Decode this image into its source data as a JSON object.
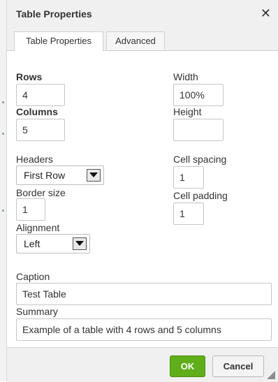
{
  "dialog": {
    "title": "Table Properties",
    "close_icon": "close-icon"
  },
  "tabs": [
    {
      "label": "Table Properties",
      "active": true
    },
    {
      "label": "Advanced",
      "active": false
    }
  ],
  "fields": {
    "rows": {
      "label": "Rows",
      "value": "4"
    },
    "columns": {
      "label": "Columns",
      "value": "5"
    },
    "width": {
      "label": "Width",
      "value": "100%"
    },
    "height": {
      "label": "Height",
      "value": ""
    },
    "headers": {
      "label": "Headers",
      "value": "First Row"
    },
    "cell_spacing": {
      "label": "Cell spacing",
      "value": "1"
    },
    "border_size": {
      "label": "Border size",
      "value": "1"
    },
    "cell_padding": {
      "label": "Cell padding",
      "value": "1"
    },
    "alignment": {
      "label": "Alignment",
      "value": "Left"
    },
    "caption": {
      "label": "Caption",
      "value": "Test Table"
    },
    "summary": {
      "label": "Summary",
      "value": "Example of a table with 4 rows and 5 columns"
    }
  },
  "buttons": {
    "ok": "OK",
    "cancel": "Cancel"
  },
  "colors": {
    "ok_button": "#5fae1a",
    "chrome_background": "#f0f0f0"
  }
}
